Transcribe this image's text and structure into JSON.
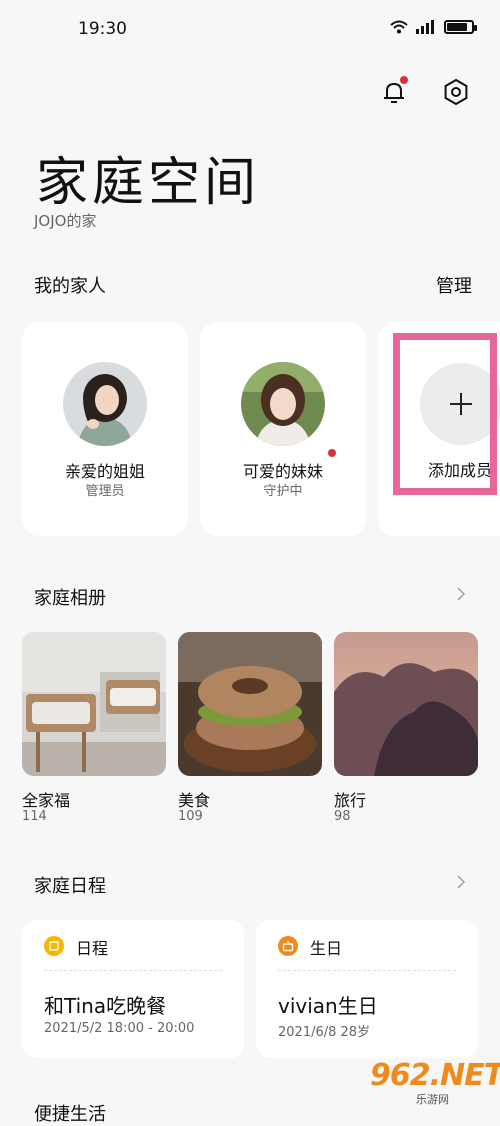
{
  "status_bar": {
    "time": "19:30",
    "battery_level": 0.85
  },
  "header": {
    "title": "家庭空间",
    "subtitle": "JOJO的家"
  },
  "family": {
    "heading": "我的家人",
    "manage_label": "管理",
    "members": [
      {
        "name": "亲爱的姐姐",
        "role": "管理员",
        "has_badge": false
      },
      {
        "name": "可爱的妹妹",
        "role": "守护中",
        "has_badge": true
      }
    ],
    "add_label": "添加成员"
  },
  "albums": {
    "heading": "家庭相册",
    "items": [
      {
        "name": "全家福",
        "count": "114"
      },
      {
        "name": "美食",
        "count": "109"
      },
      {
        "name": "旅行",
        "count": "98"
      }
    ]
  },
  "schedule": {
    "heading": "家庭日程",
    "items": [
      {
        "type": "日程",
        "title": "和Tina吃晚餐",
        "meta": "2021/5/2  18:00 - 20:00",
        "badge_color": "#f5b800"
      },
      {
        "type": "生日",
        "title": "vivian生日",
        "meta": "2021/6/8  28岁",
        "badge_color": "#f08a1c"
      }
    ]
  },
  "bottom_section": {
    "heading": "便捷生活"
  },
  "watermark": {
    "brand": "962.NET",
    "sub": "乐游网"
  },
  "colors": {
    "accent_red": "#d8313f",
    "highlight_pink": "#e8679a"
  }
}
